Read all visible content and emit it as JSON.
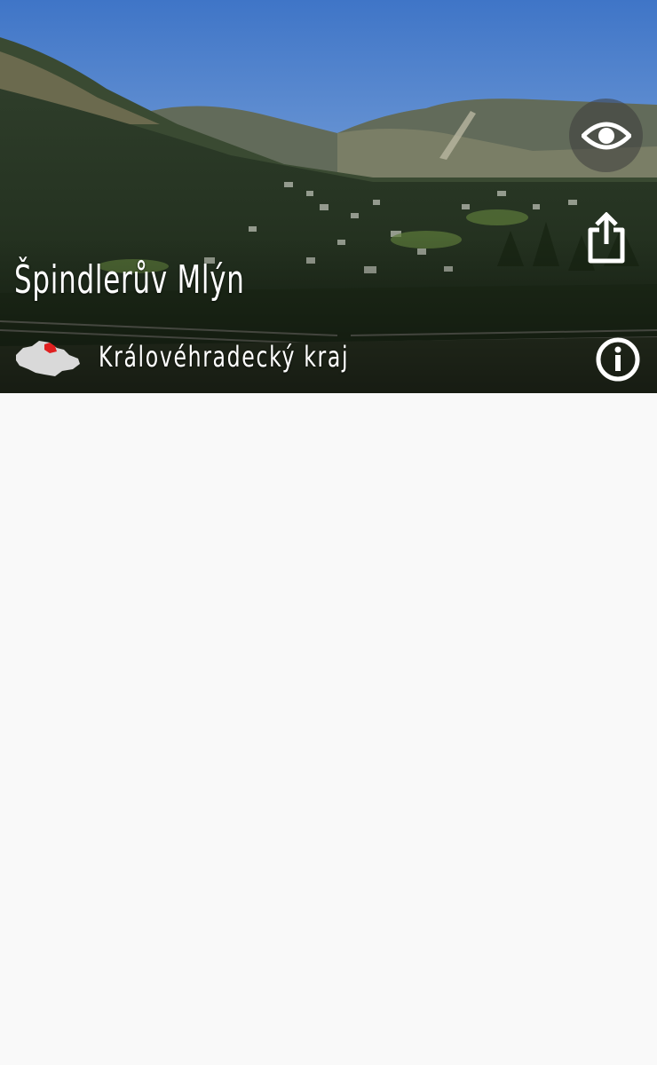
{
  "header": {
    "title": "Špindlerův Mlýn",
    "region": "Královéhradecký kraj"
  },
  "icons": {
    "view": "eye-icon",
    "share": "share-icon",
    "info": "info-icon",
    "region_map": "czech-map-icon"
  },
  "colors": {
    "overlay_button": "#3c3c3c",
    "text": "#ffffff",
    "region_highlight": "#e02020",
    "map_fill": "#d9d9d9",
    "background": "#f9f9f9"
  }
}
